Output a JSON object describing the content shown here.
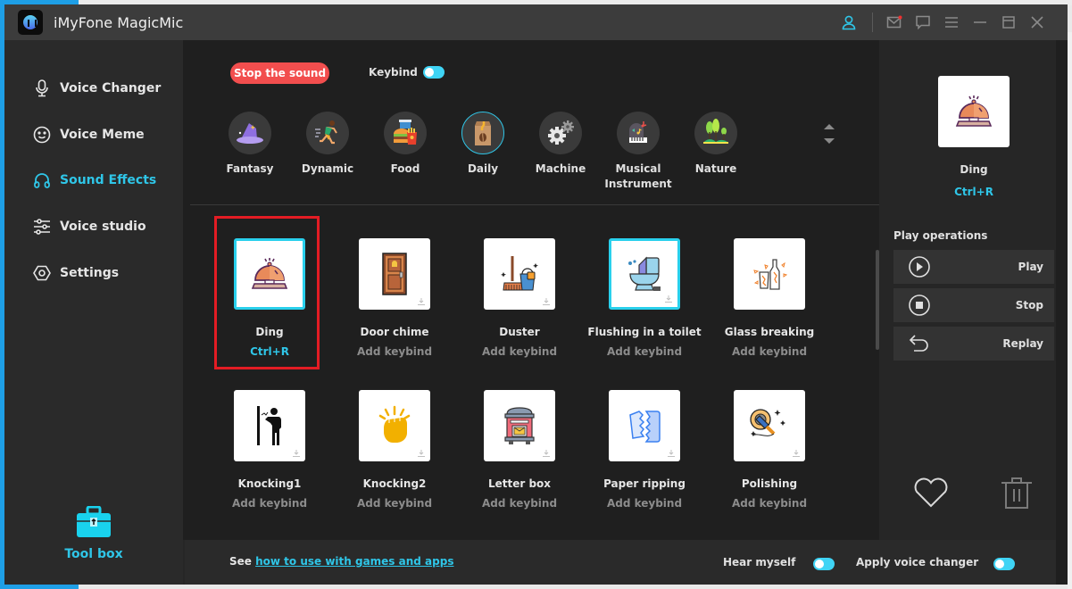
{
  "window": {
    "title": "iMyFone MagicMic"
  },
  "titlebar_icons": [
    {
      "name": "user-icon"
    },
    {
      "name": "mail-icon"
    },
    {
      "name": "feedback-icon"
    },
    {
      "name": "menu-icon"
    },
    {
      "name": "minimize-icon"
    },
    {
      "name": "maximize-icon"
    },
    {
      "name": "close-icon"
    }
  ],
  "sidebar": {
    "items": [
      {
        "label": "Voice Changer",
        "icon": "microphone-icon",
        "active": false
      },
      {
        "label": "Voice Meme",
        "icon": "smiley-icon",
        "active": false
      },
      {
        "label": "Sound Effects",
        "icon": "headphones-icon",
        "active": true
      },
      {
        "label": "Voice studio",
        "icon": "sliders-icon",
        "active": false
      },
      {
        "label": "Settings",
        "icon": "settings-hex-icon",
        "active": false
      }
    ],
    "toolbox_label": "Tool box"
  },
  "top_bar": {
    "stop_label": "Stop the sound",
    "keybind_label": "Keybind",
    "keybind_enabled": true
  },
  "categories": [
    {
      "label": "Fantasy",
      "icon": "wizard-hat-icon",
      "active": false
    },
    {
      "label": "Dynamic",
      "icon": "runner-icon",
      "active": false
    },
    {
      "label": "Food",
      "icon": "burger-fries-icon",
      "active": false
    },
    {
      "label": "Daily",
      "icon": "coffee-bag-icon",
      "active": true
    },
    {
      "label": "Machine",
      "icon": "gears-icon",
      "active": false
    },
    {
      "label": "Musical Instrument",
      "icon": "piano-icon",
      "active": false
    },
    {
      "label": "Nature",
      "icon": "trees-icon",
      "active": false
    }
  ],
  "sounds": [
    {
      "name": "Ding",
      "keybind": "Ctrl+R",
      "icon": "bell-icon",
      "selected": true
    },
    {
      "name": "Door chime",
      "keybind": "Add keybind",
      "icon": "door-icon",
      "selected": false
    },
    {
      "name": "Duster",
      "keybind": "Add keybind",
      "icon": "broom-bucket-icon",
      "selected": false
    },
    {
      "name": "Flushing in a toilet",
      "keybind": "Add keybind",
      "icon": "toilet-icon",
      "selected": true
    },
    {
      "name": "Glass breaking",
      "keybind": "Add keybind",
      "icon": "broken-glass-icon",
      "selected": false
    },
    {
      "name": "Knocking1",
      "keybind": "Add keybind",
      "icon": "knocking-person-icon",
      "selected": false
    },
    {
      "name": "Knocking2",
      "keybind": "Add keybind",
      "icon": "knocking-hand-icon",
      "selected": false
    },
    {
      "name": "Letter box",
      "keybind": "Add keybind",
      "icon": "mailbox-icon",
      "selected": false
    },
    {
      "name": "Paper ripping",
      "keybind": "Add keybind",
      "icon": "torn-paper-icon",
      "selected": false
    },
    {
      "name": "Polishing",
      "keybind": "Add keybind",
      "icon": "polisher-icon",
      "selected": false
    }
  ],
  "preview": {
    "name": "Ding",
    "keybind": "Ctrl+R"
  },
  "play_operations": {
    "label": "Play operations",
    "buttons": [
      {
        "label": "Play",
        "icon": "play-circle-icon"
      },
      {
        "label": "Stop",
        "icon": "stop-circle-icon"
      },
      {
        "label": "Replay",
        "icon": "replay-icon"
      }
    ]
  },
  "footer": {
    "see_prefix": "See",
    "link_text": "how to use with games and apps",
    "hear_myself_label": "Hear myself",
    "hear_myself_enabled": true,
    "apply_label": "Apply voice changer",
    "apply_enabled": true
  },
  "colors": {
    "accent": "#2fc6e8",
    "stop_button": "#f24e4e",
    "highlight_box": "#e31c24"
  }
}
